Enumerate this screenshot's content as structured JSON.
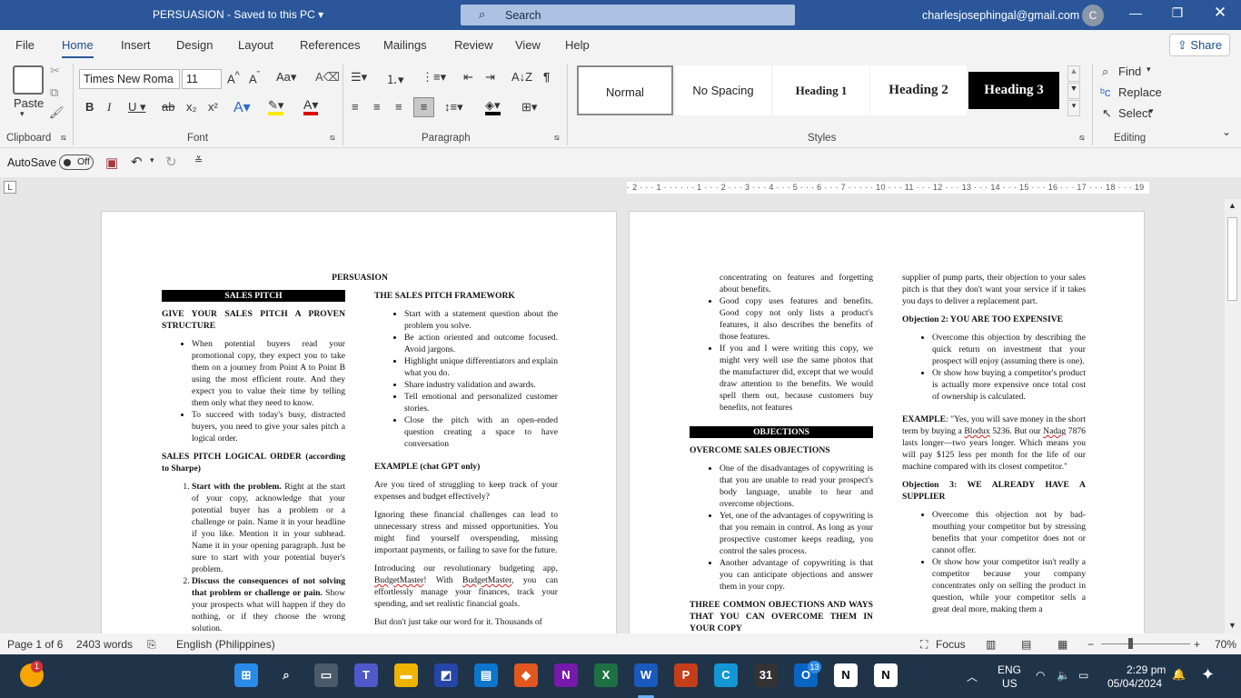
{
  "titlebar": {
    "doc_title": "PERSUASION  -  Saved to this PC  ▾",
    "search_placeholder": "Search",
    "account_email": "charlesjosephingal@gmail.com",
    "avatar_initial": "C"
  },
  "menu": {
    "tabs": [
      "File",
      "Home",
      "Insert",
      "Design",
      "Layout",
      "References",
      "Mailings",
      "Review",
      "View",
      "Help"
    ],
    "active_tab": "Home",
    "share_label": "Share"
  },
  "ribbon": {
    "clipboard": {
      "paste_label": "Paste",
      "group_label": "Clipboard"
    },
    "font": {
      "font_name": "Times New Roma",
      "font_size": "11",
      "group_label": "Font"
    },
    "paragraph": {
      "group_label": "Paragraph"
    },
    "styles": {
      "group_label": "Styles",
      "items": [
        "Normal",
        "No Spacing",
        "Heading 1",
        "Heading 2",
        "Heading 3"
      ]
    },
    "editing": {
      "group_label": "Editing",
      "find_label": "Find",
      "replace_label": "Replace",
      "select_label": "Select"
    }
  },
  "qat": {
    "autosave_label": "AutoSave",
    "autosave_state": "Off"
  },
  "ruler": {
    "text": "· 2 · · · 1 · · ·   · · · 1 · · · 2 · · · 3 · · · 4 · · · 5 · · · 6 · · · 7 · ·   · · · 10 · · · 11 · · · 12 · · · 13 · · · 14 · · · 15 · · · 16 · · · 17 · · · 18 · · · 19"
  },
  "page1": {
    "title": "PERSUASION",
    "col1": {
      "bar": "SALES PITCH",
      "h1": "GIVE YOUR SALES PITCH A PROVEN STRUCTURE",
      "b1": "When potential buyers read your promotional copy, they expect you to take them on a journey from Point A to Point B using the most efficient route. And they expect you to value their time by telling them only what they need to know.",
      "b2": "To succeed with today's busy, distracted buyers, you need to give your sales pitch a logical order.",
      "h2": "SALES PITCH LOGICAL ORDER (according to Sharpe)",
      "n1_bold": "Start with the problem.",
      "n1_text": " Right at the start of your copy, acknowledge that your potential buyer has a problem or a challenge or pain. Name it in your headline if you like. Mention it in your subhead. Name it in your opening paragraph. Just be sure to start with your potential buyer's problem.",
      "n2_bold": "Discuss the consequences of not solving that problem or challenge or pain.",
      "n2_text": " Show your prospects what will happen if they do nothing, or if they choose the wrong solution."
    },
    "col2": {
      "h1": "THE SALES PITCH FRAMEWORK",
      "bullets": [
        "Start with a statement question about the problem you solve.",
        "Be action oriented and outcome focused. Avoid jargons.",
        "Highlight unique differentiators and explain what you do.",
        "Share industry validation and awards.",
        "Tell emotional and personalized customer stories.",
        "Close the pitch with an open-ended question creating a space to have conversation"
      ],
      "h2": "EXAMPLE (chat GPT only)",
      "p1": "Are you tired of struggling to keep track of your expenses and budget effectively?",
      "p2": "Ignoring these financial challenges can lead to unnecessary stress and missed opportunities. You might find yourself overspending, missing important payments, or failing to save for the future.",
      "p3a": "Introducing our revolutionary budgeting app, ",
      "p3b": "BudgetMaster",
      "p3c": "! With ",
      "p3d": "BudgetMaster",
      "p3e": ", you can effortlessly manage your finances, track your spending, and set realistic financial goals.",
      "p4": "But don't just take our word for it. Thousands of"
    }
  },
  "page2": {
    "col1": {
      "b0": "concentrating on features and forgetting about benefits.",
      "b1": "Good copy uses features and benefits. Good copy not only lists a product's features, it also describes the benefits of those features.",
      "b2": "If you and I were writing this copy, we might very well use the same photos that the manufacturer did, except that we would draw attention to the benefits. We would spell them out, because customers buy benefits, not features",
      "bar": "OBJECTIONS",
      "h1": "OVERCOME SALES OBJECTIONS",
      "o1": "One of the disadvantages of copywriting is that you are unable to read your prospect's body language, unable to hear and overcome objections.",
      "o2": "Yet, one of the advantages of copywriting is that you remain in control. As long as your prospective customer keeps reading, you control the sales process.",
      "o3": "Another advantage of copywriting is that you can anticipate objections and answer them in your copy.",
      "h2": "THREE COMMON OBJECTIONS AND WAYS THAT YOU CAN OVERCOME THEM IN YOUR COPY"
    },
    "col2": {
      "p0": "supplier of pump parts, their objection to your sales pitch is that they don't want your service if it takes you days to deliver a replacement part.",
      "h1": "Objection 2: YOU ARE TOO EXPENSIVE",
      "b1": "Overcome this objection by describing the quick return on investment that your prospect will enjoy (assuming there is one).",
      "b2": "Or show how buying a competitor's product is actually more expensive once total cost of ownership is calculated.",
      "ex_label": "EXAMPLE",
      "ex_a": ": \"Yes, you will save money in the short term by buying a ",
      "ex_b": "Blodux",
      "ex_c": " 5236. But our ",
      "ex_d": "Nadag",
      "ex_e": " 7876 lasts longer—two years longer. Which means you will pay $125 less per month for the life of our machine compared with its closest competitor.\"",
      "h2": "Objection 3: WE ALREADY HAVE A SUPPLIER",
      "b3": "Overcome this objection not by bad-mouthing your competitor but by stressing benefits that your competitor does not or cannot offer.",
      "b4": "Or show how your competitor isn't really a competitor because your company concentrates only on selling the product in question, while your competitor sells a great deal more, making them a"
    }
  },
  "status": {
    "page": "Page 1 of 6",
    "words": "2403 words",
    "language": "English (Philippines)",
    "focus": "Focus",
    "zoom": "70%"
  },
  "taskbar": {
    "notif_count": "1",
    "outlook_badge": "13",
    "lang_line1": "ENG",
    "lang_line2": "US",
    "time": "2:29 pm",
    "date": "05/04/2024"
  }
}
